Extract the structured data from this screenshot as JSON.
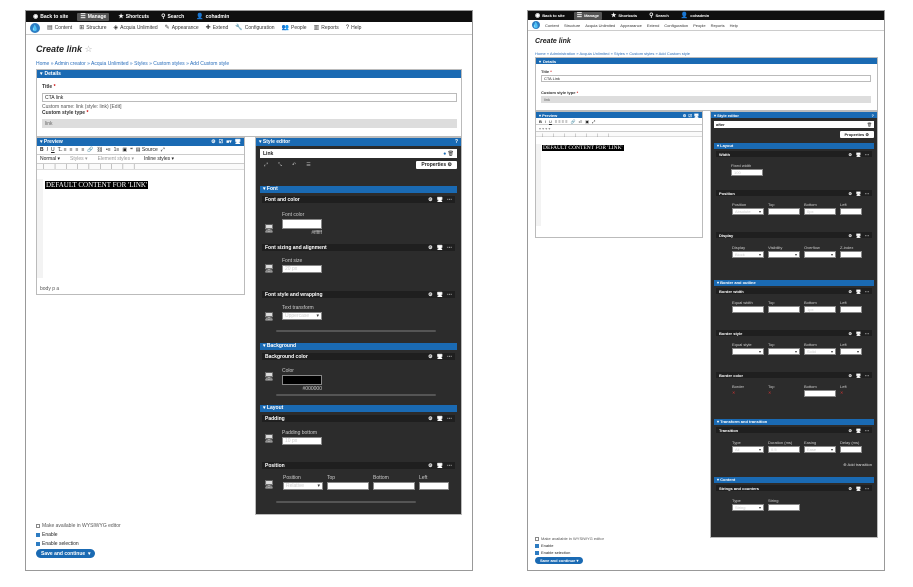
{
  "toolbar": {
    "back": "Back to site",
    "manage": "Manage",
    "shortcuts": "Shortcuts",
    "search": "Search",
    "user": "cohadmin"
  },
  "menu": {
    "content": "Content",
    "structure": "Structure",
    "access_unlimited": "Acquia Unlimited",
    "appearance": "Appearance",
    "extend": "Extend",
    "configuration": "Configuration",
    "people": "People",
    "reports": "Reports",
    "help": "Help"
  },
  "left": {
    "title": "Create ",
    "title_em": "link",
    "breadcrumb": "Home » Admin creator » Acquia Unlimited » Styles » Custom styles » Add Custom style",
    "details_label": "Details",
    "title_label": "Title",
    "title_value": "CTA link",
    "machine_hint": "Custom name: link (style: link) [Edit]",
    "type_label": "Custom style type",
    "type_value": "link",
    "preview_label": "Preview",
    "format_normal": "Normal",
    "format_styles": "Styles",
    "format_elements": "Element styles",
    "format_inline": "Inline styles",
    "source_label": "Source",
    "default_content": "DEFAULT CONTENT FOR 'LINK'",
    "path": "body  p  a",
    "style_editor_label": "Style editor",
    "link_value": "Link",
    "properties": "Properties",
    "font_section": "Font",
    "font_color_group": "Font and color",
    "font_color_label": "Font color",
    "font_color_hex": "#ffffff",
    "font_sizing_group": "Font sizing and alignment",
    "font_size_label": "Font size",
    "font_size_value": "20 px",
    "font_style_group": "Font style and wrapping",
    "text_transform_label": "Text transform",
    "text_transform_value": "Uppercase",
    "background_section": "Background",
    "bg_color_group": "Background color",
    "bg_color_label": "Color",
    "bg_color_hex": "#000000",
    "layout_section": "Layout",
    "padding_group": "Padding",
    "padding_bottom_label": "Padding bottom",
    "padding_bottom_value": "10 px",
    "position_group": "Position",
    "position_label": "Position",
    "position_value": "Relative",
    "top_label": "Top",
    "bottom_label": "Bottom",
    "left_label": "Left",
    "wysiwyg_label": "Make available in WYSIWYG editor",
    "enable_label": "Enable",
    "enable_selection_label": "Enable selection",
    "save_label": "Save and continue"
  },
  "right": {
    "title": "Create ",
    "title_em": "link",
    "breadcrumb": "Home » Administration » Acquia Unlimited » Styles » Custom styles » Add Custom style",
    "details_label": "Details",
    "title_label": "Title",
    "title_value": "CTA Link",
    "type_label": "Custom style type",
    "type_value": "link",
    "preview_label": "Preview",
    "default_content": "DEFAULT CONTENT FOR 'LINK'",
    "style_editor_label": "Style editor",
    "sel_value": "after",
    "properties": "Properties",
    "layout_section": "Layout",
    "width_group": "Width",
    "fixed_width_label": "Fixed width",
    "fixed_width_value": "100",
    "position_group": "Position",
    "position_label": "Position",
    "position_value": "Absolute",
    "top_label": "Top",
    "bottom_label": "Bottom",
    "bottom_value": "0px",
    "left_label": "Left",
    "display_group": "Display",
    "display_label": "Display",
    "display_value": "Block",
    "visibility_label": "Visibility",
    "overflow_label": "Overflow",
    "zindex_label": "Z-index",
    "border_section": "Border and outline",
    "border_width_group": "Border width",
    "equal_width_label": "Equal width",
    "bw_bottom_value": "1px",
    "border_style_group": "Border style",
    "equal_style_label": "Equal style",
    "bs_bottom_value": "Solid",
    "border_color_group": "Border color",
    "border_color_label": "Border",
    "transform_section": "Transform and transition",
    "transition_group": "Transition",
    "transition_type_label": "Type",
    "transition_type_value": "All",
    "duration_label": "Duration (ms)",
    "duration_value": "0.5",
    "easing_label": "Easing",
    "easing_value": "Ease",
    "delay_label": "Delay (ms)",
    "add_transition": "Add transition",
    "content_section": "Content",
    "strings_group": "Strings and counters",
    "str_type_label": "Type",
    "str_type_value": "String",
    "str_label": "String",
    "wysiwyg_label": "Make available in WYSIWYG editor",
    "enable_label": "Enable",
    "enable_selection_label": "Enable selection",
    "save_label": "Save and continue"
  }
}
